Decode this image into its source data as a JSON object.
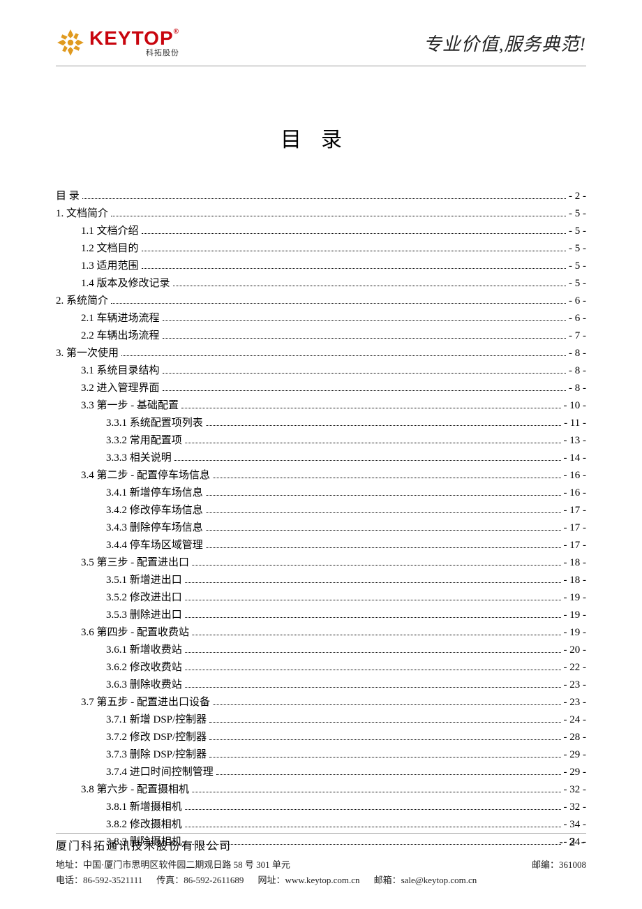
{
  "header": {
    "logo_main": "KEYTOP",
    "logo_reg": "®",
    "logo_sub": "科拓股份",
    "slogan": "专业价值,服务典范!"
  },
  "title": "目录",
  "toc": [
    {
      "indent": 0,
      "label": "目  录",
      "page": "- 2 -"
    },
    {
      "indent": 0,
      "label": "1. 文档简介",
      "page": "- 5 -"
    },
    {
      "indent": 1,
      "label": "1.1 文档介绍",
      "page": "- 5 -"
    },
    {
      "indent": 1,
      "label": "1.2 文档目的",
      "page": "- 5 -"
    },
    {
      "indent": 1,
      "label": "1.3 适用范围",
      "page": "- 5 -"
    },
    {
      "indent": 1,
      "label": "1.4 版本及修改记录",
      "page": "- 5 -"
    },
    {
      "indent": 0,
      "label": "2. 系统简介",
      "page": "- 6 -"
    },
    {
      "indent": 1,
      "label": "2.1 车辆进场流程",
      "page": "- 6 -"
    },
    {
      "indent": 1,
      "label": "2.2 车辆出场流程",
      "page": "- 7 -"
    },
    {
      "indent": 0,
      "label": "3. 第一次使用",
      "page": "- 8 -"
    },
    {
      "indent": 1,
      "label": "3.1 系统目录结构",
      "page": "- 8 -"
    },
    {
      "indent": 1,
      "label": "3.2 进入管理界面",
      "page": "- 8 -"
    },
    {
      "indent": 1,
      "label": "3.3 第一步 - 基础配置",
      "page": "- 10 -"
    },
    {
      "indent": 2,
      "label": "3.3.1 系统配置项列表",
      "page": "- 11 -"
    },
    {
      "indent": 2,
      "label": "3.3.2 常用配置项",
      "page": "- 13 -"
    },
    {
      "indent": 2,
      "label": "3.3.3 相关说明",
      "page": "- 14 -"
    },
    {
      "indent": 1,
      "label": "3.4 第二步 - 配置停车场信息",
      "page": "- 16 -"
    },
    {
      "indent": 2,
      "label": "3.4.1 新增停车场信息",
      "page": "- 16 -"
    },
    {
      "indent": 2,
      "label": "3.4.2 修改停车场信息",
      "page": "- 17 -"
    },
    {
      "indent": 2,
      "label": "3.4.3 删除停车场信息",
      "page": "- 17 -"
    },
    {
      "indent": 2,
      "label": "3.4.4 停车场区域管理",
      "page": "- 17 -"
    },
    {
      "indent": 1,
      "label": "3.5 第三步 - 配置进出口",
      "page": "- 18 -"
    },
    {
      "indent": 2,
      "label": "3.5.1 新增进出口",
      "page": "- 18 -"
    },
    {
      "indent": 2,
      "label": "3.5.2 修改进出口",
      "page": "- 19 -"
    },
    {
      "indent": 2,
      "label": "3.5.3 删除进出口",
      "page": "- 19 -"
    },
    {
      "indent": 1,
      "label": "3.6 第四步 - 配置收费站",
      "page": "- 19 -"
    },
    {
      "indent": 2,
      "label": "3.6.1 新增收费站",
      "page": "- 20 -"
    },
    {
      "indent": 2,
      "label": "3.6.2 修改收费站",
      "page": "- 22 -"
    },
    {
      "indent": 2,
      "label": "3.6.3 删除收费站",
      "page": "- 23 -"
    },
    {
      "indent": 1,
      "label": "3.7 第五步 - 配置进出口设备",
      "page": "- 23 -"
    },
    {
      "indent": 2,
      "label": "3.7.1 新增 DSP/控制器",
      "page": "- 24 -"
    },
    {
      "indent": 2,
      "label": "3.7.2 修改 DSP/控制器",
      "page": "- 28 -"
    },
    {
      "indent": 2,
      "label": "3.7.3 删除 DSP/控制器",
      "page": "- 29 -"
    },
    {
      "indent": 2,
      "label": "3.7.4  进口时间控制管理",
      "page": "- 29 -"
    },
    {
      "indent": 1,
      "label": "3.8 第六步 - 配置摄相机",
      "page": "- 32 -"
    },
    {
      "indent": 2,
      "label": "3.8.1 新增摄相机",
      "page": "- 32 -"
    },
    {
      "indent": 2,
      "label": "3.8.2 修改摄相机",
      "page": "- 34 -"
    },
    {
      "indent": 2,
      "label": "3.8.3 删除摄相机",
      "page": "- 34 -"
    }
  ],
  "footer": {
    "company": "厦门科拓通讯技术股份有限公司",
    "page_number": "- 2 -",
    "address_label": "地址：",
    "address": "中国·厦门市思明区软件园二期观日路 58 号 301 单元",
    "postcode_label": "邮编：",
    "postcode": "361008",
    "tel_label": "电话：",
    "tel": "86-592-3521111",
    "fax_label": "传真：",
    "fax": "86-592-2611689",
    "web_label": "网址：",
    "web": "www.keytop.com.cn",
    "email_label": "邮箱：",
    "email": "sale@keytop.com.cn"
  }
}
